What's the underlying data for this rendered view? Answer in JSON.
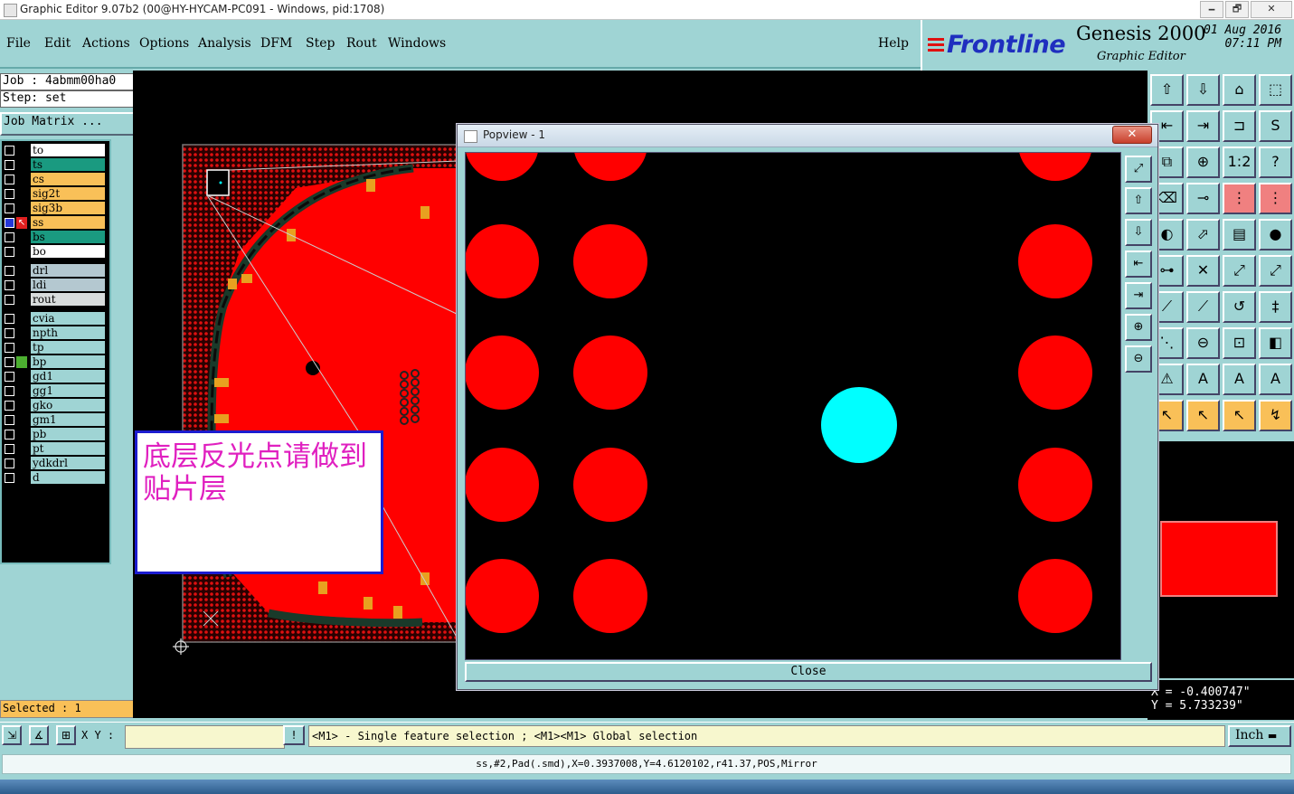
{
  "window": {
    "title": "Graphic Editor 9.07b2 (00@HY-HYCAM-PC091 - Windows, pid:1708)",
    "min_glyph": "🗕",
    "max_glyph": "🗗",
    "close_glyph": "✕"
  },
  "menu": {
    "items": [
      "File",
      "Edit",
      "Actions",
      "Options",
      "Analysis",
      "DFM",
      "Step",
      "Rout",
      "Windows"
    ],
    "help": "Help"
  },
  "brand": {
    "logo": "Frontline",
    "product": "Genesis 2000",
    "subtitle": "Graphic Editor",
    "date": "01 Aug 2016",
    "time": "07:11 PM"
  },
  "job": {
    "job_label": "Job  : 4abmm00ha0",
    "step_label": "Step: set",
    "matrix_button": "Job Matrix ..."
  },
  "layers": [
    {
      "name": "to",
      "color": "#ffffff",
      "checked": false
    },
    {
      "name": "ts",
      "color": "#1a9a80",
      "checked": false
    },
    {
      "name": "cs",
      "color": "#f9c058",
      "checked": false
    },
    {
      "name": "sig2t",
      "color": "#f9c058",
      "checked": false
    },
    {
      "name": "sig3b",
      "color": "#f9c058",
      "checked": false
    },
    {
      "name": "ss",
      "color": "#f9c058",
      "checked": true,
      "active": true
    },
    {
      "name": "bs",
      "color": "#1a9a80",
      "checked": false
    },
    {
      "name": "bo",
      "color": "#ffffff",
      "checked": false
    },
    {
      "name": "drl",
      "color": "#b4c8d0",
      "checked": false
    },
    {
      "name": "ldi",
      "color": "#b4c8d0",
      "checked": false
    },
    {
      "name": "rout",
      "color": "#d8dcdc",
      "checked": false
    },
    {
      "name": "cvia",
      "color": "#9fd4d4",
      "checked": false
    },
    {
      "name": "npth",
      "color": "#9fd4d4",
      "checked": false
    },
    {
      "name": "tp",
      "color": "#9fd4d4",
      "checked": false
    },
    {
      "name": "bp",
      "color": "#9fd4d4",
      "checked": false,
      "marker": "#4caf30"
    },
    {
      "name": "gd1",
      "color": "#9fd4d4",
      "checked": false
    },
    {
      "name": "gg1",
      "color": "#9fd4d4",
      "checked": false
    },
    {
      "name": "gko",
      "color": "#9fd4d4",
      "checked": false
    },
    {
      "name": "gm1",
      "color": "#9fd4d4",
      "checked": false
    },
    {
      "name": "pb",
      "color": "#9fd4d4",
      "checked": false
    },
    {
      "name": "pt",
      "color": "#9fd4d4",
      "checked": false
    },
    {
      "name": "ydkdrl",
      "color": "#9fd4d4",
      "checked": false
    },
    {
      "name": "d",
      "color": "#9fd4d4",
      "checked": false
    }
  ],
  "selected": "Selected : 1",
  "popview": {
    "title": "Popview - 1",
    "close_x": "✕",
    "close_label": "Close"
  },
  "note": {
    "text": "底层反光点请做到贴片层"
  },
  "coords": {
    "x": "X  = -0.400747\"",
    "y": "Y  = 5.733239\""
  },
  "bottom": {
    "xy_label": "X Y :",
    "xy_value": "",
    "warn_glyph": "!",
    "hint": "<M1> - Single feature selection ; <M1><M1> Global selection",
    "unit": "Inch",
    "status": "ss,#2,Pad(.smd),X=0.3937008,Y=4.6120102,r41.37,POS,Mirror"
  },
  "colors": {
    "panel": "#9fd4d4",
    "pad_red": "#ff0000",
    "highlight_cyan": "#00ffff",
    "note_text": "#e020c0",
    "note_border": "#1c1cd0"
  }
}
